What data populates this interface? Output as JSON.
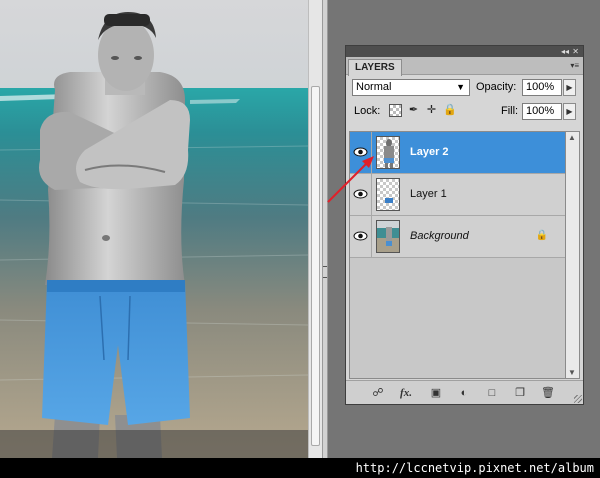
{
  "panel": {
    "title_tab": "LAYERS",
    "panel_controls": [
      "◂◂",
      "✕"
    ],
    "menu_icon": "panel-menu-icon",
    "blend_mode": "Normal",
    "opacity_label": "Opacity:",
    "opacity_value": "100%",
    "lock_label": "Lock:",
    "lock_icons": [
      "lock-transparent-pixels-icon",
      "lock-image-pixels-icon",
      "lock-position-icon",
      "lock-all-icon"
    ],
    "fill_label": "Fill:",
    "fill_value": "100%",
    "layers": [
      {
        "name": "Layer 2",
        "selected": true,
        "visible": true
      },
      {
        "name": "Layer 1",
        "selected": false,
        "visible": true
      },
      {
        "name": "Background",
        "selected": false,
        "visible": true,
        "locked": true
      }
    ],
    "footer_icons": [
      "link-layers-icon",
      "layer-style-fx-icon",
      "add-mask-icon",
      "adjustment-layer-icon",
      "new-group-folder-icon",
      "new-layer-icon",
      "trash-icon"
    ],
    "footer_fx_glyph": "fx."
  },
  "colors": {
    "selection": "#3d8fd9",
    "annotation_arrow": "#e0202a",
    "workspace": "#757575"
  },
  "watermark": "http://lccnetvip.pixnet.net/album"
}
